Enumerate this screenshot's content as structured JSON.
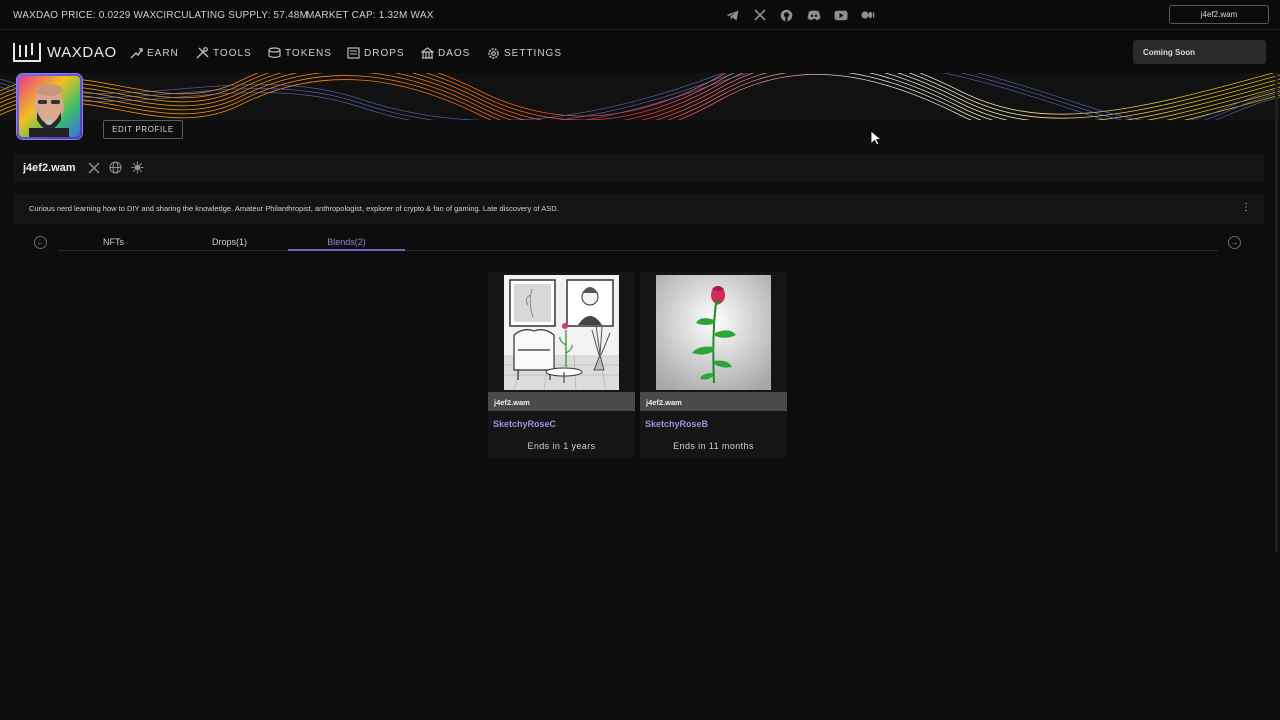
{
  "ticker": {
    "price": "WAXDAO PRICE: 0.0229 WAX",
    "supply": "CIRCULATING SUPPLY: 57.48M",
    "market_cap": "MARKET CAP: 1.32M WAX",
    "social_icons": [
      "telegram-icon",
      "x-icon",
      "github-icon",
      "discord-icon",
      "youtube-icon",
      "medium-icon"
    ],
    "wallet_label": "j4ef2.wam"
  },
  "nav": {
    "logo_text": "WAXDAO",
    "items": [
      {
        "label": "EARN",
        "icon": "earn-icon"
      },
      {
        "label": "TOOLS",
        "icon": "tools-icon"
      },
      {
        "label": "TOKENS",
        "icon": "tokens-icon"
      },
      {
        "label": "DROPS",
        "icon": "drops-icon"
      },
      {
        "label": "DAOS",
        "icon": "daos-icon"
      },
      {
        "label": "SETTINGS",
        "icon": "settings-icon"
      }
    ],
    "coming_soon": "Coming Soon"
  },
  "profile": {
    "edit_label": "EDIT PROFILE",
    "name": "j4ef2.wam",
    "bio": "Curious nerd learning how to DIY and sharing the knowledge. Amateur Philanthropist, anthropologist, explorer of crypto & fan of gaming. Late discovery of ASD.",
    "menu_dots": "⋮"
  },
  "tabs": [
    {
      "label": "NFTs",
      "active": false
    },
    {
      "label": "Drops(1)",
      "active": false
    },
    {
      "label": "Blends(2)",
      "active": true
    }
  ],
  "cards": [
    {
      "owner": "j4ef2.wam",
      "title": "SketchyRoseC",
      "ends": "Ends in 1 years"
    },
    {
      "owner": "j4ef2.wam",
      "title": "SketchyRoseB",
      "ends": "Ends in 11 months"
    }
  ],
  "colors": {
    "accent": "#8d85d6",
    "background": "#0d0d0d"
  }
}
